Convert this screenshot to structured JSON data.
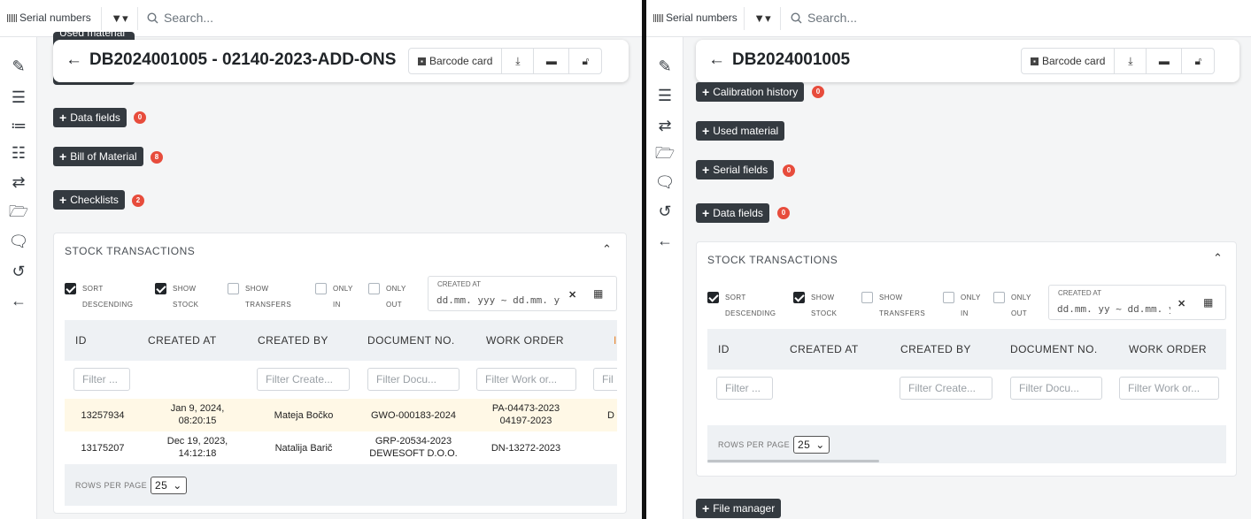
{
  "left": {
    "topbar": {
      "serial_label": "Serial numbers",
      "filter_label": "▼▾",
      "search_placeholder": "Search..."
    },
    "header": {
      "title": "DB2024001005 - 02140-2023-ADD-ONS",
      "back_icon": "arrow-left-icon",
      "barcode_label": "Barcode card"
    },
    "clipped_button": "Used material",
    "sections": [
      {
        "label": "Data fields",
        "badge": "0"
      },
      {
        "label": "Bill of Material",
        "badge": "8"
      },
      {
        "label": "Checklists",
        "badge": "2"
      }
    ],
    "stock": {
      "title": "STOCK TRANSACTIONS",
      "options": [
        {
          "l1": "SORT",
          "l2": "DESCENDING",
          "checked": true
        },
        {
          "l1": "SHOW",
          "l2": "STOCK",
          "checked": true
        },
        {
          "l1": "SHOW",
          "l2": "TRANSFERS",
          "checked": false
        },
        {
          "l1": "ONLY",
          "l2": "IN",
          "checked": false
        },
        {
          "l1": "ONLY",
          "l2": "OUT",
          "checked": false
        }
      ],
      "created_at_label": "CREATED AT",
      "date_range": "dd.mm. yyy ~ dd.mm. yyy",
      "columns": [
        "ID",
        "CREATED AT",
        "CREATED BY",
        "DOCUMENT NO.",
        "WORK ORDER",
        "I"
      ],
      "filters": [
        "Filter ...",
        "Filter Create...",
        "Filter Docu...",
        "Filter Work or...",
        "Fil"
      ],
      "rows": [
        {
          "id": "13257934",
          "created_at": "Jan 9, 2024, 08:20:15",
          "created_by": "Mateja Bočko",
          "document_no": "GWO-000183-2024",
          "work_order": "PA-04473-2023 04197-2023",
          "extra": "D"
        },
        {
          "id": "13175207",
          "created_at": "Dec 19, 2023, 14:12:18",
          "created_by": "Natalija Barič",
          "document_no": "GRP-20534-2023 DEWESOFT D.O.O.",
          "work_order": "DN-13272-2023",
          "extra": ""
        }
      ],
      "rows_per_page_label": "ROWS PER PAGE",
      "rows_per_page": "25"
    }
  },
  "right": {
    "topbar": {
      "serial_label": "Serial numbers",
      "filter_label": "▼▾",
      "search_placeholder": "Search..."
    },
    "header": {
      "title": "DB2024001005",
      "back_icon": "arrow-left-icon",
      "barcode_label": "Barcode card"
    },
    "sections": [
      {
        "label": "Calibration history",
        "badge": "0"
      },
      {
        "label": "Used material",
        "badge": ""
      },
      {
        "label": "Serial fields",
        "badge": "0"
      },
      {
        "label": "Data fields",
        "badge": "0"
      }
    ],
    "stock": {
      "title": "STOCK TRANSACTIONS",
      "options": [
        {
          "l1": "SORT",
          "l2": "DESCENDING",
          "checked": true
        },
        {
          "l1": "SHOW",
          "l2": "STOCK",
          "checked": true
        },
        {
          "l1": "SHOW",
          "l2": "TRANSFERS",
          "checked": false
        },
        {
          "l1": "ONLY",
          "l2": "IN",
          "checked": false
        },
        {
          "l1": "ONLY",
          "l2": "OUT",
          "checked": false
        }
      ],
      "created_at_label": "CREATED AT",
      "date_range": "dd.mm. yy ~ dd.mm. yy",
      "columns": [
        "ID",
        "CREATED AT",
        "CREATED BY",
        "DOCUMENT NO.",
        "WORK ORDER"
      ],
      "filters": [
        "Filter ...",
        "Filter Create...",
        "Filter Docu...",
        "Filter Work or..."
      ],
      "rows_per_page_label": "ROWS PER PAGE",
      "rows_per_page": "25"
    },
    "file_manager": "File manager"
  },
  "sidebar_icons": [
    "edit-icon",
    "table-icon",
    "list-ordered-icon",
    "checklist-icon",
    "transfer-icon",
    "folder-icon",
    "comments-icon",
    "history-icon",
    "back-arrow-icon"
  ],
  "colors": {
    "badge": "#e74c3c",
    "button": "#343a40",
    "highlight_row": "#fff8e6"
  }
}
